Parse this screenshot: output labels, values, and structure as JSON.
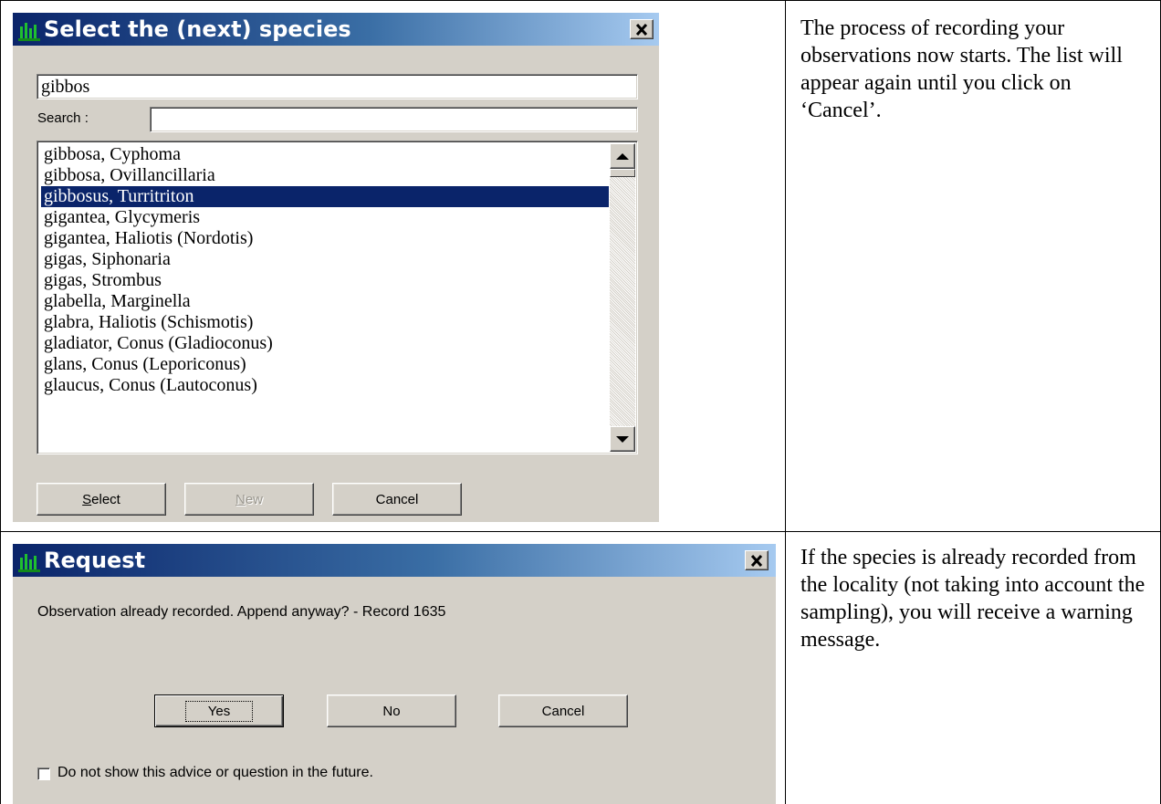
{
  "species_dialog": {
    "title": "Select the (next) species",
    "query_value": "gibbos",
    "search_label": "Search :",
    "search_value": "",
    "items": [
      "gibbosa, Cyphoma",
      "gibbosa, Ovillancillaria",
      "gibbosus, Turritriton",
      "gigantea, Glycymeris",
      "gigantea, Haliotis (Nordotis)",
      "gigas, Siphonaria",
      "gigas, Strombus",
      "glabella, Marginella",
      "glabra, Haliotis (Schismotis)",
      "gladiator, Conus (Gladioconus)",
      "glans, Conus (Leporiconus)",
      "glaucus, Conus (Lautoconus)"
    ],
    "selected_item": "gibbosus, Turritriton",
    "buttons": {
      "select": "Select",
      "new": "New",
      "cancel": "Cancel"
    }
  },
  "request_dialog": {
    "title": "Request",
    "message": "Observation already recorded. Append anyway? - Record 1635",
    "buttons": {
      "yes": "Yes",
      "no": "No",
      "cancel": "Cancel"
    },
    "checkbox_label": "Do not show this advice or question in the future."
  },
  "captions": {
    "first": "The process of recording your observations now starts. The list will appear again until you click on ‘Cancel’.",
    "second": "If the species is already recorded from the locality (not taking into account the sampling), you will receive a warning message."
  }
}
